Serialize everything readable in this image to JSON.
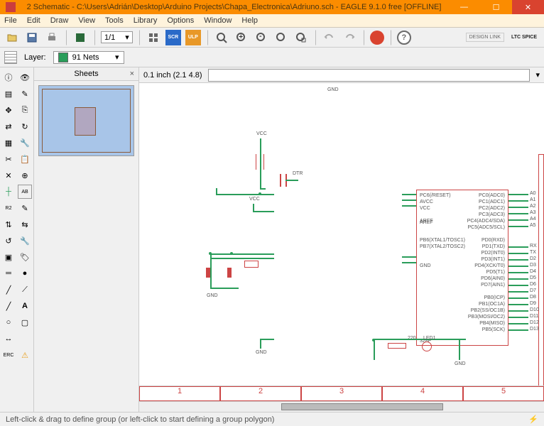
{
  "title": "2 Schematic - C:\\Users\\Adrián\\Desktop\\Arduino Projects\\Chapa_Electronica\\Adriuno.sch - EAGLE 9.1.0 free [OFFLINE]",
  "menu": {
    "file": "File",
    "edit": "Edit",
    "draw": "Draw",
    "view": "View",
    "tools": "Tools",
    "library": "Library",
    "options": "Options",
    "window": "Window",
    "help": "Help"
  },
  "zoom": "1/1",
  "layer_label": "Layer:",
  "layer_value": "91 Nets",
  "sheets_title": "Sheets",
  "coord": "0.1 inch (2.1 4.8)",
  "cmd_value": "",
  "status": "Left-click & drag to define group (or left-click to start defining a group polygon)",
  "ruler": [
    "1",
    "2",
    "3",
    "4",
    "5"
  ],
  "scr": "SCR",
  "ulp": "ULP",
  "design_link": "DESIGN LINK",
  "ltspice": "LTC SPICE",
  "gnd_top": "GND",
  "chip": {
    "vcc": "VCC",
    "dtr": "DTR",
    "gnd": "GND",
    "part": "328P",
    "aref": "AREF",
    "avcc": "AVCC",
    "left": [
      "PC6(/RESET)",
      "AVCC",
      "VCC",
      "",
      "AREF",
      "",
      "",
      "PB6(XTAL1/TOSC1)",
      "PB7(XTAL2/TOSC2)",
      "",
      "",
      "GND"
    ],
    "right": [
      "PC0(ADC0)",
      "PC1(ADC1)",
      "PC2(ADC2)",
      "PC3(ADC3)",
      "PC4(ADC4/SDA)",
      "PC5(ADC5/SCL)",
      "",
      "PD0(RXD)",
      "PD1(TXD)",
      "PD2(INT0)",
      "PD3(INT1)",
      "PD4(XCK/T0)",
      "PD5(T1)",
      "PD6(AIN0)",
      "PD7(AIN1)",
      "",
      "PB0(ICP)",
      "PB1(OC1A)",
      "PB2(SS/OC1B)",
      "PB3(MOSI/OC2)",
      "PB4(MISO)",
      "PB5(SCK)"
    ]
  },
  "nets": {
    "a": [
      "A0",
      "A1",
      "A2",
      "A3",
      "A4",
      "A5"
    ],
    "d": [
      "RX",
      "TX",
      "D2",
      "D3",
      "D4",
      "D5",
      "D6",
      "D7",
      "D8",
      "D9",
      "D10",
      "D11",
      "D12",
      "D13"
    ]
  },
  "led": {
    "r": "220",
    "name": "LED1",
    "r_name": "R1"
  },
  "chart_data": null
}
